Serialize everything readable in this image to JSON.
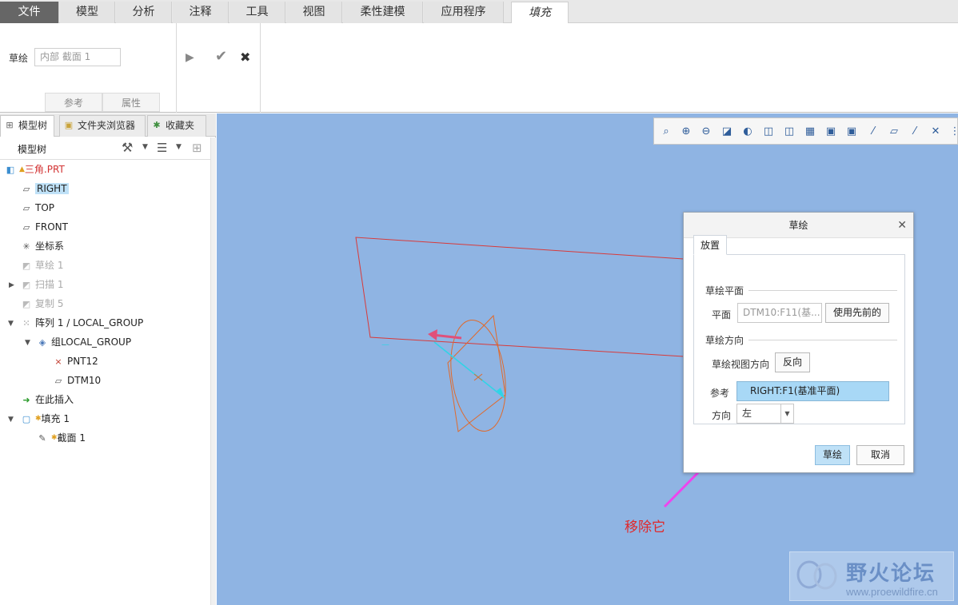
{
  "ribbon_tabs": [
    {
      "label": "文件"
    },
    {
      "label": "模型"
    },
    {
      "label": "分析"
    },
    {
      "label": "注释"
    },
    {
      "label": "工具"
    },
    {
      "label": "视图"
    },
    {
      "label": "柔性建模"
    },
    {
      "label": "应用程序"
    },
    {
      "label": "填充"
    }
  ],
  "ribbon": {
    "sketch_label": "草绘",
    "sketch_value": "内部 截面 1",
    "sub_tabs": [
      "参考",
      "属性"
    ]
  },
  "left_panel": {
    "tabs": [
      {
        "label": "模型树"
      },
      {
        "label": "文件夹浏览器"
      },
      {
        "label": "收藏夹"
      }
    ],
    "toolbar_title": "模型树",
    "tree": [
      {
        "label": "三角.PRT",
        "icon": "part-icon"
      },
      {
        "label": "RIGHT",
        "icon": "datum-plane-icon"
      },
      {
        "label": "TOP",
        "icon": "datum-plane-icon"
      },
      {
        "label": "FRONT",
        "icon": "datum-plane-icon"
      },
      {
        "label": "坐标系",
        "icon": "csys-icon"
      },
      {
        "label": "草绘 1",
        "icon": "sketch-icon"
      },
      {
        "label": "扫描 1",
        "icon": "sweep-icon"
      },
      {
        "label": "复制 5",
        "icon": "copy-icon"
      },
      {
        "label": "阵列 1 / LOCAL_GROUP",
        "icon": "pattern-icon"
      },
      {
        "label": "组LOCAL_GROUP",
        "icon": "group-icon"
      },
      {
        "label": "PNT12",
        "icon": "datum-point-icon"
      },
      {
        "label": "DTM10",
        "icon": "datum-plane-icon"
      },
      {
        "label": "在此插入",
        "icon": "insert-arrow-icon"
      },
      {
        "label": "填充 1",
        "icon": "fill-icon"
      },
      {
        "label": "截面 1",
        "icon": "section-icon"
      }
    ]
  },
  "dialog": {
    "title": "草绘",
    "tab": "放置",
    "section_plane": "草绘平面",
    "plane_label": "平面",
    "plane_value": "DTM10:F11(基...",
    "use_previous": "使用先前的",
    "section_orient": "草绘方向",
    "view_dir_label": "草绘视图方向",
    "flip": "反向",
    "ref_label": "参考",
    "ref_value": "RIGHT:F1(基准平面)",
    "dir_label": "方向",
    "dir_value": "左",
    "ok": "草绘",
    "cancel": "取消"
  },
  "annotation": {
    "callout": "移除它",
    "arrow_color": "#ee44ee"
  },
  "watermark": {
    "title": "野火论坛",
    "url": "www.proewildfire.cn"
  },
  "colors": {
    "viewport_bg": "#8fb4e3",
    "selection": "#bfe1f7"
  }
}
